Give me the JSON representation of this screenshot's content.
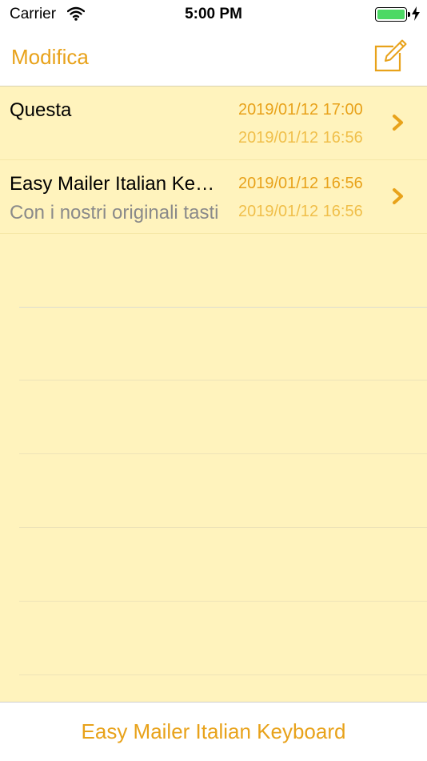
{
  "status": {
    "carrier": "Carrier",
    "time": "5:00 PM",
    "battery_color": "#4cd964"
  },
  "nav": {
    "edit_label": "Modifica",
    "compose_icon": "compose-icon"
  },
  "notes": [
    {
      "title": "Questa",
      "subtitle": "",
      "modified": "2019/01/12 17:00",
      "created": "2019/01/12 16:56"
    },
    {
      "title": "Easy Mailer Italian Ke…",
      "subtitle": "Con i nostri originali tasti",
      "modified": "2019/01/12 16:56",
      "created": "2019/01/12 16:56"
    }
  ],
  "footer": {
    "link_label": "Easy Mailer Italian Keyboard"
  },
  "colors": {
    "accent": "#e8a21a",
    "paper": "#fff3bd"
  }
}
